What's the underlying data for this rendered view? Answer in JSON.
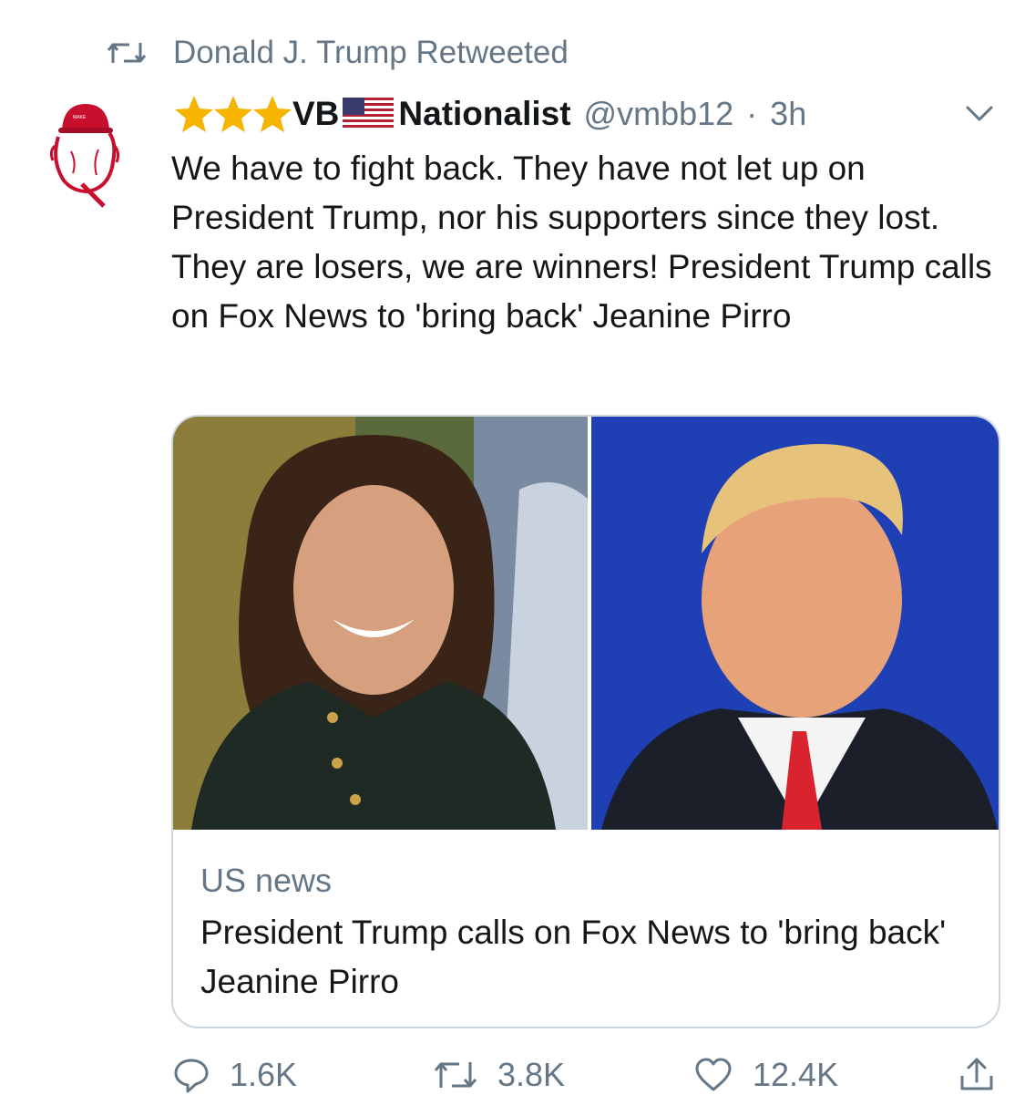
{
  "retweet_context": {
    "icon": "retweet-icon",
    "text": "Donald J. Trump Retweeted"
  },
  "tweet": {
    "author": {
      "display_name_prefix": "VB",
      "display_name_suffix": "Nationalist",
      "name_emojis": [
        "star-icon",
        "star-icon",
        "star-icon",
        "us-flag-icon"
      ],
      "handle": "@vmbb12",
      "separator": "·",
      "time": "3h",
      "avatar": "avatar-icon"
    },
    "text": "We have to fight back. They have not let up on President Trump, nor his supporters since they lost. They are losers, we are winners! President Trump calls on Fox News to 'bring back' Jeanine Pirro",
    "card": {
      "source": "US news",
      "title": "President Trump calls on Fox News to 'bring back' Jeanine Pirro"
    },
    "actions": {
      "replies": "1.6K",
      "retweets": "3.8K",
      "likes": "12.4K"
    }
  },
  "colors": {
    "text_primary": "#14171a",
    "text_secondary": "#657786",
    "border": "#ccd6dd",
    "star": "#f4b400"
  }
}
